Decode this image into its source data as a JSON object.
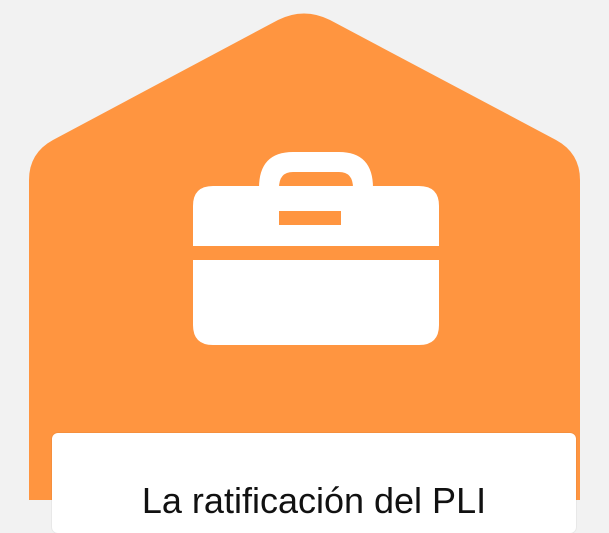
{
  "badge": {
    "color": "#FF9540",
    "icon": "briefcase-icon",
    "label": "La ratificación del PLI"
  },
  "background_color": "#F2F2F2"
}
